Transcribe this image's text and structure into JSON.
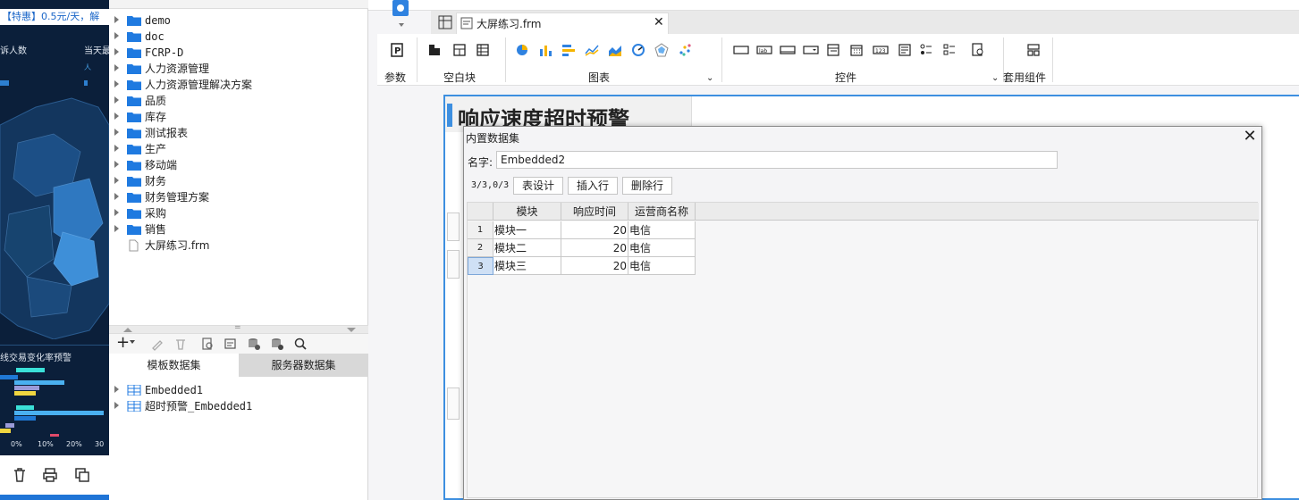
{
  "left_dashboard": {
    "promo_text": "【特惠】0.5元/天，解",
    "label_persons": "诉人数",
    "label_today": "当天最",
    "label_unit": "人",
    "label_chart_title": "线交易变化率预警",
    "axis_ticks": [
      "0%",
      "10%",
      "20%",
      "30"
    ]
  },
  "tree": {
    "items": [
      {
        "label": "demo",
        "type": "folder",
        "mono": true
      },
      {
        "label": "doc",
        "type": "folder",
        "mono": true
      },
      {
        "label": "FCRP-D",
        "type": "folder",
        "mono": true
      },
      {
        "label": "人力资源管理",
        "type": "folder",
        "mono": false
      },
      {
        "label": "人力资源管理解决方案",
        "type": "folder",
        "mono": false
      },
      {
        "label": "品质",
        "type": "folder",
        "mono": false
      },
      {
        "label": "库存",
        "type": "folder",
        "mono": false
      },
      {
        "label": "测试报表",
        "type": "folder",
        "mono": false
      },
      {
        "label": "生产",
        "type": "folder",
        "mono": false
      },
      {
        "label": "移动端",
        "type": "folder",
        "mono": false
      },
      {
        "label": "财务",
        "type": "folder",
        "mono": false
      },
      {
        "label": "财务管理方案",
        "type": "folder",
        "mono": false
      },
      {
        "label": "采购",
        "type": "folder",
        "mono": false
      },
      {
        "label": "销售",
        "type": "folder",
        "mono": false
      },
      {
        "label": "大屏练习.frm",
        "type": "file",
        "mono": false
      }
    ]
  },
  "datasets": {
    "tab_template": "模板数据集",
    "tab_server": "服务器数据集",
    "items": [
      "Embedded1",
      "超时预警_Embedded1"
    ]
  },
  "editor": {
    "file_tab": "大屏练习.frm",
    "ribbon": {
      "param": "参数",
      "blank": "空白块",
      "chart": "图表",
      "widget": "控件",
      "package": "套用组件"
    },
    "canvas_title": "响应速度超时预警"
  },
  "dialog": {
    "title": "内置数据集",
    "name_label": "名字:",
    "name_value": "Embedded2",
    "row_count": "3/3,0/3",
    "btn_design": "表设计",
    "btn_insert": "插入行",
    "btn_delete": "删除行",
    "columns": [
      "模块",
      "响应时间",
      "运营商名称"
    ],
    "rows": [
      {
        "num": "1",
        "cells": [
          "模块一",
          "20",
          "电信"
        ]
      },
      {
        "num": "2",
        "cells": [
          "模块二",
          "20",
          "电信"
        ]
      },
      {
        "num": "3",
        "cells": [
          "模块三",
          "20",
          "电信"
        ]
      }
    ]
  },
  "colors": {
    "accent": "#3d8fe0",
    "folder": "#1f7ae0",
    "dark_panel": "#0b1f3a"
  }
}
